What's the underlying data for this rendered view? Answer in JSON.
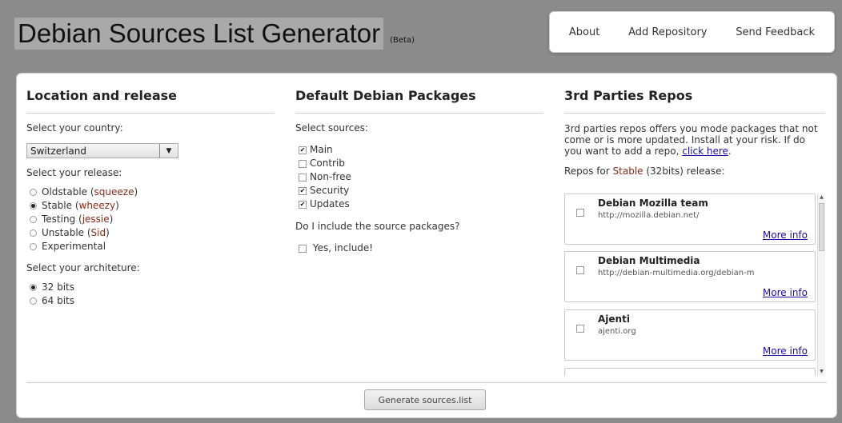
{
  "header": {
    "title": "Debian Sources List Generator",
    "beta": "(Beta)"
  },
  "nav": [
    "About",
    "Add Repository",
    "Send Feedback"
  ],
  "location": {
    "heading": "Location and release",
    "country_label": "Select your country:",
    "country_value": "Switzerland",
    "release_label": "Select your release:",
    "releases": [
      {
        "label": "Oldstable",
        "code": "squeeze",
        "selected": false
      },
      {
        "label": "Stable",
        "code": "wheezy",
        "selected": true
      },
      {
        "label": "Testing",
        "code": "jessie",
        "selected": false
      },
      {
        "label": "Unstable",
        "code": "Sid",
        "selected": false
      },
      {
        "label": "Experimental",
        "code": "",
        "selected": false
      }
    ],
    "arch_label": "Select your architeture:",
    "archs": [
      {
        "label": "32 bits",
        "selected": true
      },
      {
        "label": "64 bits",
        "selected": false
      }
    ]
  },
  "packages": {
    "heading": "Default Debian Packages",
    "sources_label": "Select sources:",
    "sources": [
      {
        "label": "Main",
        "checked": true
      },
      {
        "label": "Contrib",
        "checked": false
      },
      {
        "label": "Non-free",
        "checked": false
      },
      {
        "label": "Security",
        "checked": true
      },
      {
        "label": "Updates",
        "checked": true
      }
    ],
    "include_label": "Do I include the source packages?",
    "include_option": "Yes, include!"
  },
  "third": {
    "heading": "3rd Parties Repos",
    "desc": "3rd parties repos offers you mode packages that not come or is more updated. Install at your risk. If do you want to add a repo, ",
    "link": "click here",
    "desc_end": ".",
    "repos_prefix": "Repos for ",
    "repos_release": "Stable",
    "repos_suffix": " (32bits) release:",
    "repos": [
      {
        "name": "Debian Mozilla team",
        "url": "http://mozilla.debian.net/",
        "more": "More info"
      },
      {
        "name": "Debian Multimedia",
        "url": "http://debian-multimedia.org/debian-m",
        "more": "More info"
      },
      {
        "name": "Ajenti",
        "url": "ajenti.org",
        "more": "More info"
      }
    ]
  },
  "generate_label": "Generate sources.list",
  "colors": {
    "accent_red": "#8b2b18",
    "link": "#1a0dab",
    "background": "#8b8b8b"
  }
}
